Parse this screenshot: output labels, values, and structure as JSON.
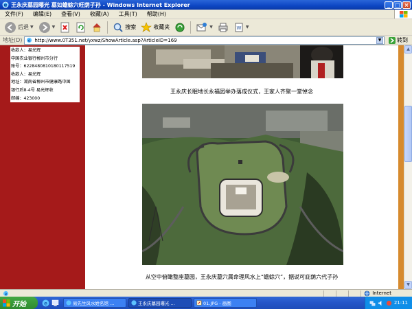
{
  "window": {
    "title": "王永庆墓园曝光 墓如蟾蜍穴旺荫子孙 - Windows Internet Explorer"
  },
  "menu": {
    "items": [
      "文件(F)",
      "编辑(E)",
      "查看(V)",
      "收藏(A)",
      "工具(T)",
      "帮助(H)"
    ]
  },
  "toolbar": {
    "back_label": "后退",
    "search_label": "搜索",
    "favorites_label": "收藏夹"
  },
  "address": {
    "label": "地址(D)",
    "url": "http://www.0T351.net/yxwz/ShowArticle.asp?ArticleID=169",
    "go_label": "转到"
  },
  "sidebar": {
    "info_lines": [
      "收款人：易光辉",
      "中国农业银行郴州市分行",
      "账号：622848081018011751​9",
      "收款人：易光辉",
      "地址：湖南省郴州市健康路中国",
      "银行后8-4号 易光辉收",
      "邮编：423000"
    ]
  },
  "article": {
    "caption1": "王永庆长眠地长永福园举办落成仪式，王家人齐聚一堂悼念",
    "caption2": "从空中俯瞰整座墓园，王永庆墓穴属命理风水上“蟾蜍穴”，据说可庇荫六代子孙"
  },
  "statusbar": {
    "zone_label": "Internet"
  },
  "taskbar": {
    "start_label": "开始",
    "items": [
      "易先生风水姓名馆 ...",
      "王永庆墓园曝光 ...",
      "01.JPG - 画图"
    ],
    "clock": "21:11"
  },
  "colors": {
    "left_bar": "#a51a1a",
    "right_bar": "#d68a2e",
    "titlebar": "#0d46c4",
    "taskbar": "#2455c8",
    "start": "#2f8a2f"
  }
}
